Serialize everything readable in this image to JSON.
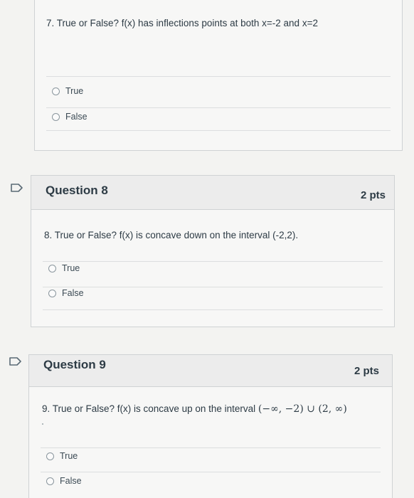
{
  "q7": {
    "text": "7. True or False? f(x) has inflections points at both x=-2 and x=2",
    "answers": [
      "True",
      "False"
    ]
  },
  "q8": {
    "title": "Question 8",
    "points": "2 pts",
    "text": "8. True or False? f(x) is concave down on the interval (-2,2).",
    "answers": [
      "True",
      "False"
    ]
  },
  "q9": {
    "title": "Question 9",
    "points": "2 pts",
    "text_prefix": "9. True or False? f(x) is concave up on the interval",
    "text_math": "(−∞, −2) ∪ (2, ∞)",
    "answers": [
      "True",
      "False"
    ]
  },
  "icons": {
    "flag": "flag-icon",
    "radio": "radio-icon"
  }
}
